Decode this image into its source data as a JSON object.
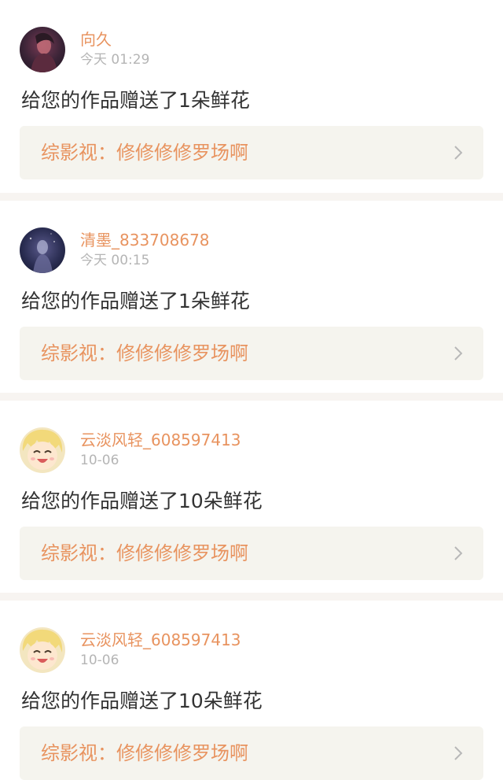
{
  "colors": {
    "accent": "#e8935f",
    "tab_indicator": "#e87a9b",
    "card_link_bg": "#f5f4ee",
    "separator": "#f7f4f1"
  },
  "notifications": [
    {
      "avatar_icon": "avatar-dark-portrait",
      "username": "向久",
      "timestamp": "今天 01:29",
      "message": "给您的作品赠送了1朵鲜花",
      "work_title": "综影视：修修修修罗场啊"
    },
    {
      "avatar_icon": "avatar-night-figure",
      "username": "清墨_833708678",
      "timestamp": "今天 00:15",
      "message": "给您的作品赠送了1朵鲜花",
      "work_title": "综影视：修修修修罗场啊"
    },
    {
      "avatar_icon": "avatar-smiling-anime",
      "username": "云淡风轻_608597413",
      "timestamp": "10-06",
      "message": "给您的作品赠送了10朵鲜花",
      "work_title": "综影视：修修修修罗场啊"
    },
    {
      "avatar_icon": "avatar-smiling-anime",
      "username": "云淡风轻_608597413",
      "timestamp": "10-06",
      "message": "给您的作品赠送了10朵鲜花",
      "work_title": "综影视：修修修修罗场啊"
    }
  ]
}
